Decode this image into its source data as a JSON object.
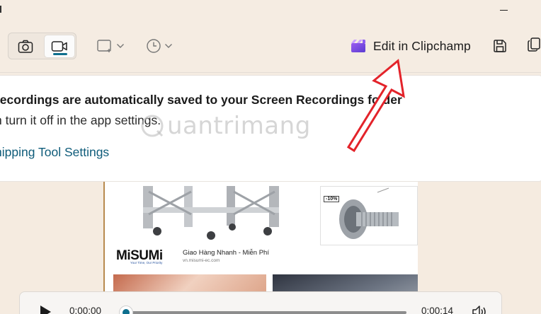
{
  "toolbar": {
    "modes": [
      {
        "icon": "camera-icon"
      },
      {
        "icon": "video-camera-icon",
        "selected": true
      }
    ],
    "shape_icon": "rectangle-snip-icon",
    "timer_icon": "clock-icon",
    "edit_clipchamp_label": "Edit in Clipchamp",
    "clipchamp_icon": "clipchamp-icon",
    "save_icon": "save-icon",
    "copy_icon": "copy-icon"
  },
  "notification": {
    "line1": "recordings are automatically saved to your Screen Recordings folder",
    "line2": "n turn it off in the app settings.",
    "link": "nipping Tool Settings"
  },
  "watermark": "uantrimang",
  "preview": {
    "discount": "-10%",
    "brand": "MiSUMi",
    "brand_tagline": "Your Time, Our Priority",
    "brand_text": "Giao Hàng Nhanh - Miễn Phí",
    "brand_url": "vn.misumi-ec.com"
  },
  "player": {
    "current_time": "0:00:00",
    "duration": "0:00:14",
    "progress": 0
  },
  "colors": {
    "accent": "#0e6f8e",
    "background": "#f5ece2",
    "annotation_arrow": "#e3232a"
  }
}
